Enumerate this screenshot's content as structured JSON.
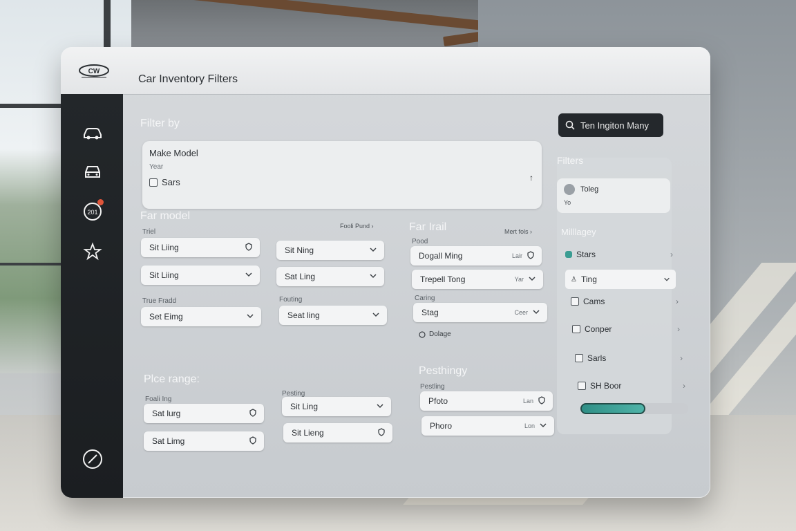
{
  "app": {
    "logo": "CW",
    "title": "Car Inventory Filters"
  },
  "search": {
    "label": "Ten Ingiton Many"
  },
  "sidebar": {
    "items": [
      {
        "icon": "car-icon"
      },
      {
        "icon": "car-front-icon"
      },
      {
        "icon": "speed-badge-icon",
        "text": "201"
      },
      {
        "icon": "star-icon"
      },
      {
        "icon": "compass-icon"
      }
    ]
  },
  "filter_by": {
    "heading": "Filter by",
    "make_model": "Make Model",
    "year": "Year",
    "sars_label": "Sars"
  },
  "far_model": {
    "heading": "Far model",
    "trial_label": "Triel",
    "link": "Fooli Pund",
    "fields_left": [
      "Sit Liing",
      "Sit Liing"
    ],
    "fields_right": [
      "Sit Ning",
      "Sat Ling"
    ],
    "true_fraud_label": "True Fradd",
    "true_fraud_value": "Set Eimg",
    "fouting_label": "Fouting",
    "fouting_value": "Seat ling"
  },
  "far_mail": {
    "heading": "Far Irail",
    "link": "Mert fols",
    "pood_label": "Pood",
    "fields": [
      {
        "text": "Dogall Ming",
        "sub": "Lair"
      },
      {
        "text": "Trepell Tong",
        "sub": "Yar"
      }
    ],
    "caring_label": "Caring",
    "caring_value": "Stag",
    "caring_sub": "Ceer",
    "dolage": "Dolage"
  },
  "price_range": {
    "heading": "Plce range:",
    "left_label": "Foali Ing",
    "left_fields": [
      "Sat lurg",
      "Sat Limg"
    ],
    "right_label": "Pesting",
    "right_fields": [
      "Sit Ling",
      "Sit Lieng"
    ]
  },
  "pestingy": {
    "heading": "Pesthingy",
    "label": "Pestling",
    "fields": [
      {
        "text": "Pfoto",
        "sub": "Lan"
      },
      {
        "text": "Phoro",
        "sub": "Lon"
      }
    ]
  },
  "right_panel": {
    "filters_heading": "Filters",
    "toleg": "Toleg",
    "toleg_sub": "Yo",
    "milage_heading": "Milllagey",
    "items": [
      "Stars",
      "Ting",
      "Cams",
      "Conper",
      "Sarls",
      "SH Boor"
    ],
    "progress": 0.6,
    "accent": "#3a9c92"
  }
}
